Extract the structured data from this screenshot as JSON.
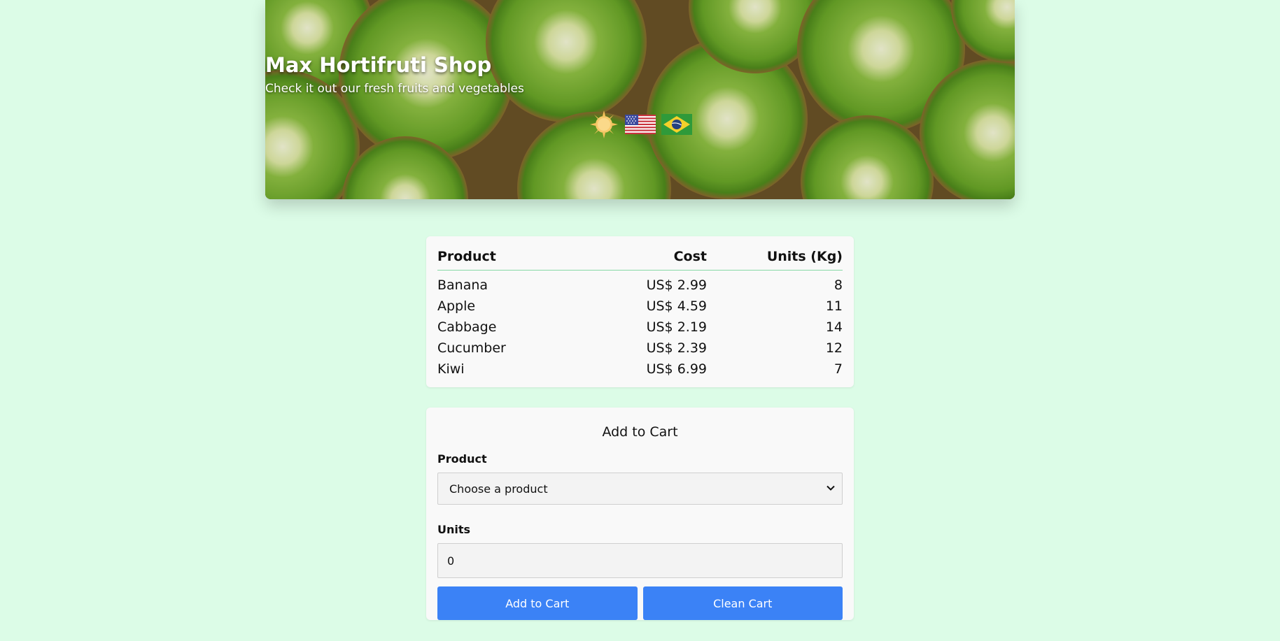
{
  "header": {
    "title": "Max Hortifruti Shop",
    "subtitle": "Check it out our fresh fruits and vegetables",
    "icons": [
      "sun-icon",
      "us-flag-icon",
      "brazil-flag-icon"
    ]
  },
  "products_table": {
    "columns": [
      "Product",
      "Cost",
      "Units (Kg)"
    ],
    "rows": [
      {
        "name": "Banana",
        "cost": "US$ 2.99",
        "units": "8"
      },
      {
        "name": "Apple",
        "cost": "US$ 4.59",
        "units": "11"
      },
      {
        "name": "Cabbage",
        "cost": "US$ 2.19",
        "units": "14"
      },
      {
        "name": "Cucumber",
        "cost": "US$ 2.39",
        "units": "12"
      },
      {
        "name": "Kiwi",
        "cost": "US$ 6.99",
        "units": "7"
      }
    ]
  },
  "cart_form": {
    "title": "Add to Cart",
    "product_label": "Product",
    "product_selected": "Choose a product",
    "units_label": "Units",
    "units_value": "0",
    "add_button": "Add to Cart",
    "clean_button": "Clean Cart"
  },
  "colors": {
    "page_background": "#dcfce7",
    "card_background": "#f9f9f9",
    "button_blue": "#3b82f6",
    "table_divider": "#86d9a6"
  }
}
